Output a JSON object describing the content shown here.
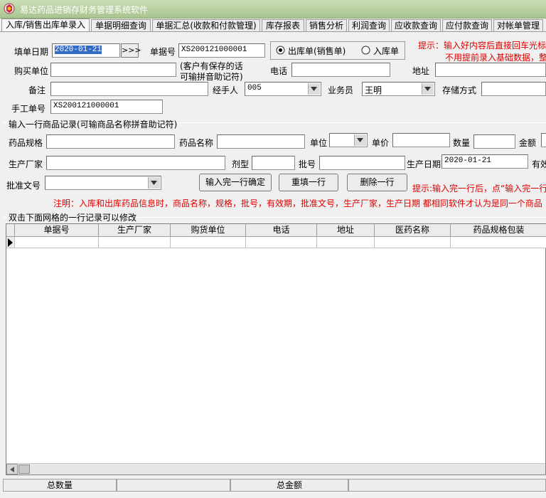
{
  "window": {
    "title": "易达药品进销存财务管理系统软件"
  },
  "tabs": [
    {
      "label": "入库/销售出库单录入"
    },
    {
      "label": "单据明细查询"
    },
    {
      "label": "单据汇总(收款和付款管理)"
    },
    {
      "label": "库存报表"
    },
    {
      "label": "销售分析"
    },
    {
      "label": "利润查询"
    },
    {
      "label": "应收款查询"
    },
    {
      "label": "应付款查询"
    },
    {
      "label": "对帐单管理"
    }
  ],
  "form": {
    "fill_date_label": "填单日期",
    "fill_date_value": "2020-01-21",
    "date_button": ">>>",
    "doc_no_label": "单据号",
    "doc_no_value": "XS200121000001",
    "radio_out": "出库单(销售单)",
    "radio_in": "入库单",
    "buyer_label": "购买单位",
    "buyer_hint_1": "(客户有保存的话",
    "buyer_hint_2": "可输拼音助记符)",
    "phone_label": "电话",
    "address_label": "地址",
    "remark_label": "备注",
    "handler_label": "经手人",
    "handler_value": "005",
    "salesman_label": "业务员",
    "salesman_value": "王明",
    "storage_label": "存储方式",
    "manual_no_label": "手工单号",
    "manual_no_value": "XS200121000001",
    "tip_1": "提示：输入好内容后直接回车光标",
    "tip_2": "不用提前录入基础数据，整"
  },
  "item_section": {
    "header": "输入一行商品记录(可输商品名称拼音助记符)",
    "spec_label": "药品规格",
    "name_label": "药品名称",
    "unit_label": "单位",
    "price_label": "单价",
    "qty_label": "数量",
    "amount_label": "金额",
    "maker_label": "生产厂家",
    "form_label": "剂型",
    "batch_label": "批号",
    "prod_date_label": "生产日期",
    "prod_date_value": "2020-01-21",
    "expiry_label": "有效",
    "approval_label": "批准文号",
    "confirm_button": "输入完一行确定",
    "refill_button": "重填一行",
    "delete_button": "删除一行",
    "tip": "提示:输入完一行后，点“输入完一行",
    "note": "注明：入库和出库药品信息时，商品名称，规格，批号，有效期，批准文号，生产厂家，生产日期  都相同软件才认为是同一个商品"
  },
  "grid": {
    "header": "双击下面网格的一行记录可以修改",
    "columns": [
      "单据号",
      "生产厂家",
      "购货单位",
      "电话",
      "地址",
      "医药名称",
      "药品规格包装"
    ]
  },
  "status": {
    "total_qty_label": "总数量",
    "total_amount_label": "总金额"
  },
  "colors": {
    "title_bar": "#b5cf9c",
    "red_text": "#e00000",
    "selection": "#316ac5"
  }
}
